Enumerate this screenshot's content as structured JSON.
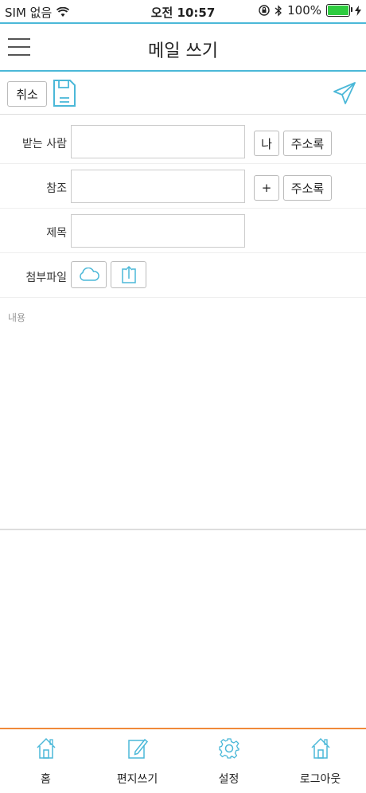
{
  "status_bar": {
    "carrier": "SIM 없음",
    "time": "오전 10:57",
    "battery": "100%"
  },
  "header": {
    "title": "메일 쓰기",
    "menu_icon": "hamburger-menu-icon"
  },
  "toolbar": {
    "cancel_label": "취소",
    "save_icon": "floppy-disk-icon",
    "send_icon": "paper-plane-icon"
  },
  "form": {
    "recipient": {
      "label": "받는 사람",
      "value": "",
      "me_button": "나",
      "address_book_button": "주소록"
    },
    "cc": {
      "label": "참조",
      "value": "",
      "add_button": "+",
      "address_book_button": "주소록"
    },
    "subject": {
      "label": "제목",
      "value": ""
    },
    "attachment": {
      "label": "첨부파일",
      "cloud_icon": "cloud-icon",
      "upload_icon": "upload-icon"
    }
  },
  "body": {
    "placeholder": "내용"
  },
  "tab_bar": {
    "items": [
      {
        "label": "홈",
        "icon": "home-icon"
      },
      {
        "label": "편지쓰기",
        "icon": "compose-icon"
      },
      {
        "label": "설정",
        "icon": "gear-icon"
      },
      {
        "label": "로그아웃",
        "icon": "logout-house-icon"
      }
    ]
  },
  "colors": {
    "accent": "#4bb8d8",
    "tab_border": "#f08a3a",
    "battery": "#2ecc40"
  }
}
